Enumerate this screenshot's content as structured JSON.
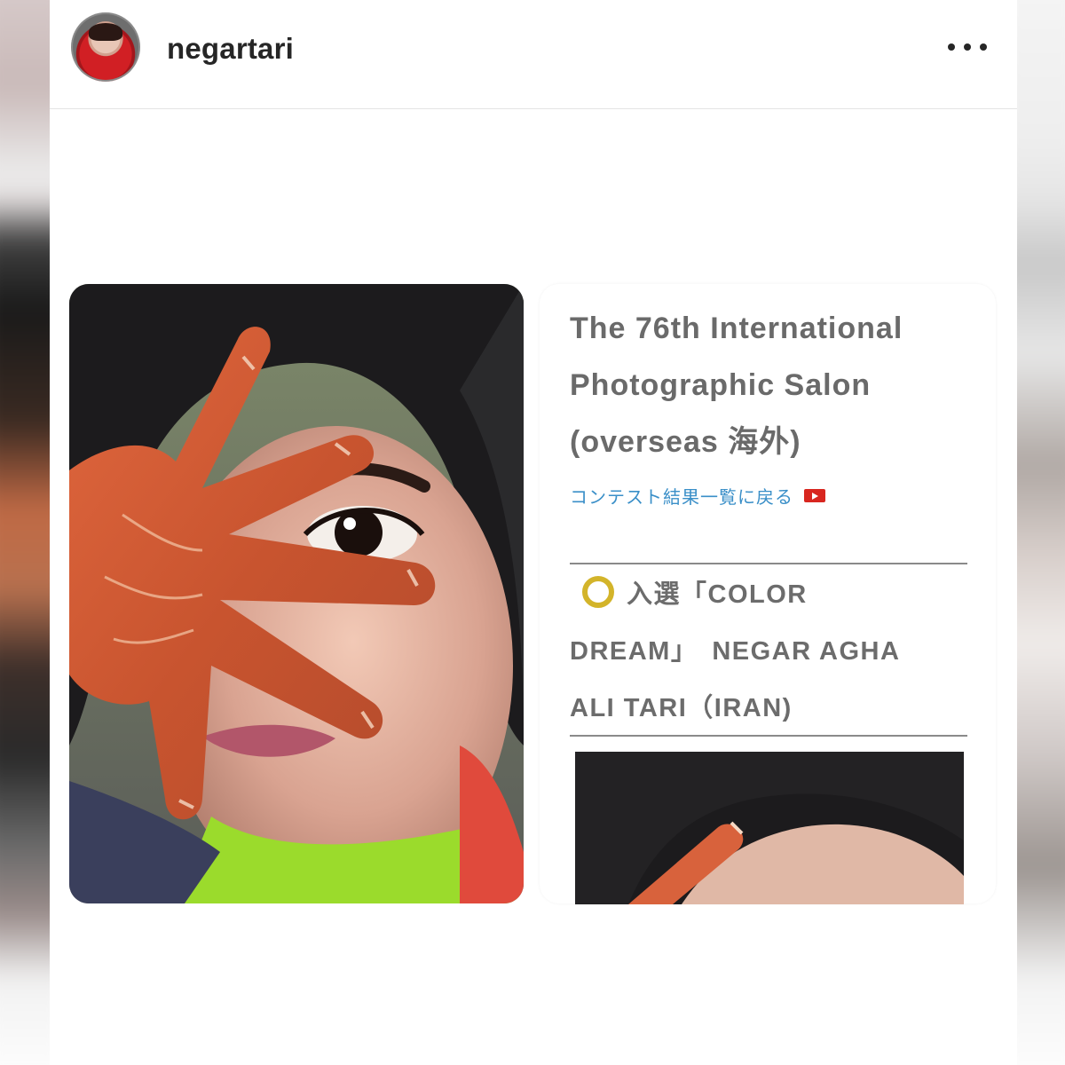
{
  "post": {
    "username": "negartari",
    "more_icon": "more-horizontal-icon"
  },
  "salon": {
    "title_line1": "The 76th International",
    "title_line2": "Photographic Salon",
    "title_line3": "(overseas 海外)",
    "back_link": "コンテスト結果一覧に戻る",
    "back_link_icon": "video-play-icon"
  },
  "award": {
    "ring_color": "#d3b42a",
    "line1": "入選「COLOR",
    "line2": "DREAM」　NEGAR AGHA",
    "line3": "ALI TARI（IRAN)"
  },
  "colors": {
    "link": "#3a8fc8",
    "title_text": "#6a6a6a",
    "username_text": "#262626"
  }
}
